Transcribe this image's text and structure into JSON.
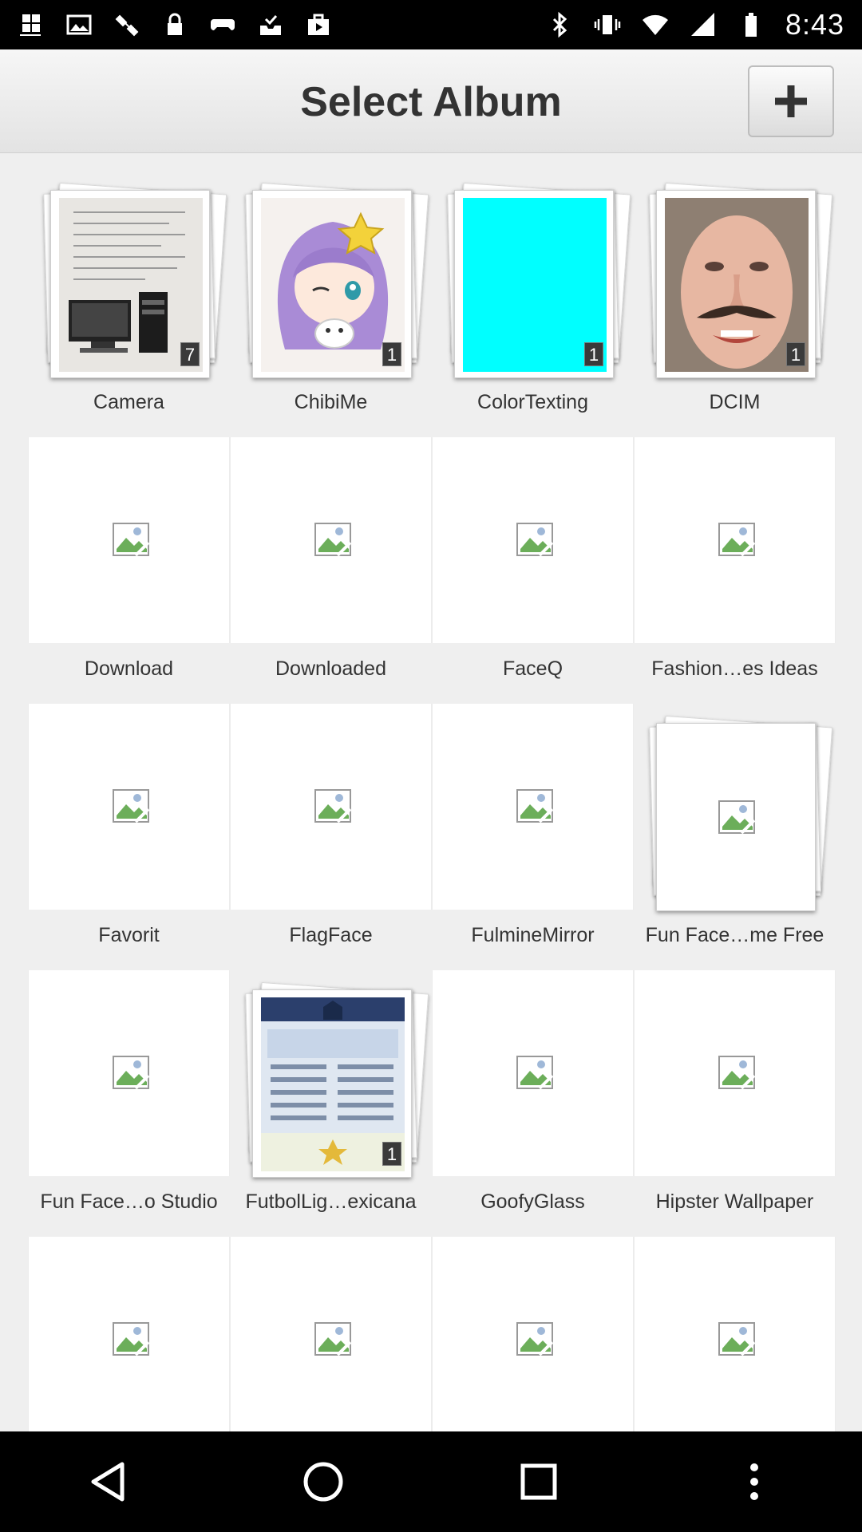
{
  "status_bar": {
    "time": "8:43",
    "left_icons": [
      "notification-icon",
      "image-icon",
      "satellite-icon",
      "lock-icon",
      "gamepad-icon",
      "tray-check-icon",
      "briefcase-icon"
    ],
    "right_icons": [
      "bluetooth-icon",
      "vibrate-icon",
      "wifi-icon",
      "signal-icon",
      "battery-icon"
    ]
  },
  "header": {
    "title": "Select Album",
    "add_button_icon": "plus-icon"
  },
  "albums": [
    {
      "name": "Camera",
      "count": "7",
      "thumb": "photo"
    },
    {
      "name": "ChibiMe",
      "count": "1",
      "thumb": "photo"
    },
    {
      "name": "ColorTexting",
      "count": "1",
      "thumb": "cyan"
    },
    {
      "name": "DCIM",
      "count": "1",
      "thumb": "photo"
    },
    {
      "name": "Download",
      "thumb": "broken"
    },
    {
      "name": "Downloaded",
      "thumb": "broken"
    },
    {
      "name": "FaceQ",
      "thumb": "broken"
    },
    {
      "name": "Fashion…es Ideas",
      "thumb": "broken"
    },
    {
      "name": "Favorit",
      "thumb": "broken"
    },
    {
      "name": "FlagFace",
      "thumb": "broken"
    },
    {
      "name": "FulmineMirror",
      "thumb": "broken"
    },
    {
      "name": "Fun Face…me Free",
      "thumb": "broken-stack"
    },
    {
      "name": "Fun Face…o Studio",
      "thumb": "broken"
    },
    {
      "name": "FutbolLig…exicana",
      "count": "1",
      "thumb": "photo"
    },
    {
      "name": "GoofyGlass",
      "thumb": "broken"
    },
    {
      "name": "Hipster Wallpaper",
      "thumb": "broken"
    },
    {
      "name": "",
      "thumb": "broken"
    },
    {
      "name": "",
      "thumb": "broken"
    },
    {
      "name": "",
      "thumb": "broken"
    },
    {
      "name": "",
      "thumb": "broken"
    }
  ],
  "nav_bar": {
    "icons": [
      "back-icon",
      "home-icon",
      "recents-icon",
      "more-icon"
    ]
  },
  "colors": {
    "accent_cyan": "#00ffff",
    "header_text": "#333333"
  }
}
